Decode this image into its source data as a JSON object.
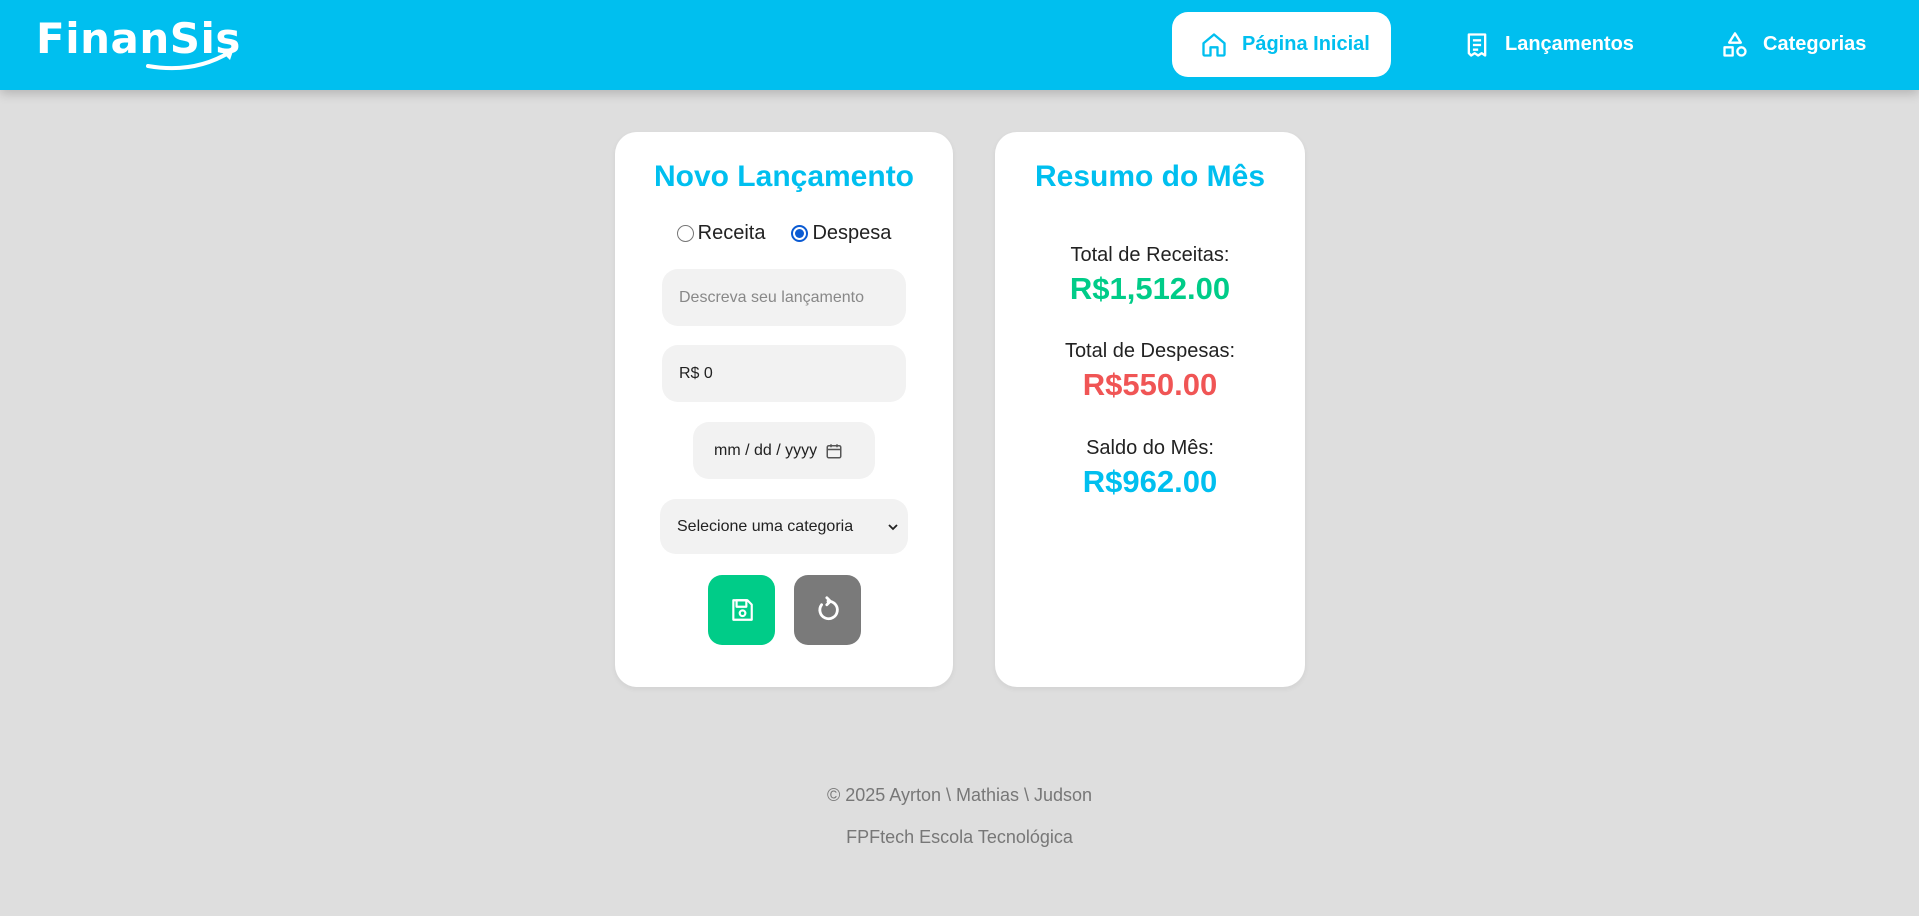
{
  "app": {
    "logo_text": "FinanSis",
    "colors": {
      "brand": "#00bfef",
      "income": "#00cc88",
      "expense": "#f05555",
      "balance": "#00bfef",
      "background": "#dedede"
    }
  },
  "nav": {
    "items": [
      {
        "label": "Página Inicial",
        "icon": "home-icon",
        "active": true
      },
      {
        "label": "Lançamentos",
        "icon": "receipt-icon",
        "active": false
      },
      {
        "label": "Categorias",
        "icon": "shapes-icon",
        "active": false
      }
    ]
  },
  "form": {
    "title": "Novo Lançamento",
    "type_options": [
      {
        "label": "Receita",
        "checked": false
      },
      {
        "label": "Despesa",
        "checked": true
      }
    ],
    "description_placeholder": "Descreva seu lançamento",
    "amount_value": "R$ 0",
    "date_placeholder": "mm / dd / yyyy",
    "category_selected": "Selecione uma categoria",
    "save_icon": "save-icon",
    "reset_icon": "reset-icon"
  },
  "summary": {
    "title": "Resumo do Mês",
    "income_label": "Total de Receitas:",
    "income_value": "R$1,512.00",
    "expense_label": "Total de Despesas:",
    "expense_value": "R$550.00",
    "balance_label": "Saldo do Mês:",
    "balance_value": "R$962.00"
  },
  "footer": {
    "line1": "© 2025 Ayrton \\ Mathias \\ Judson",
    "line2": "FPFtech Escola Tecnológica"
  }
}
